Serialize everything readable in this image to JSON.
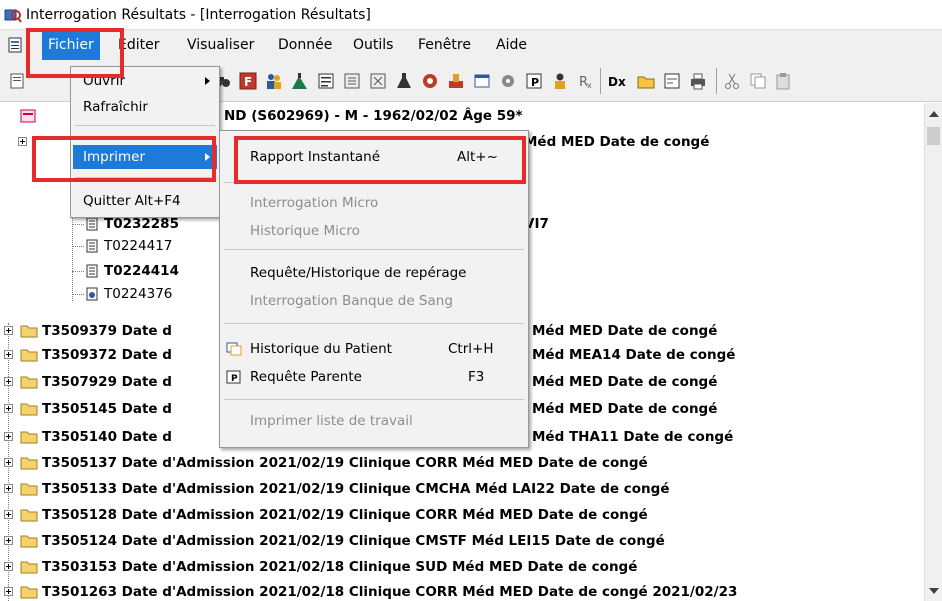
{
  "window": {
    "title": "Interrogation Résultats - [Interrogation Résultats]"
  },
  "menubar": {
    "items": [
      "Fichier",
      "Éditer",
      "Visualiser",
      "Donnée",
      "Outils",
      "Fenêtre",
      "Aide"
    ]
  },
  "toolbar": {
    "icons": [
      "print-icon",
      "binoculars-icon",
      "red-f-icon",
      "people-icon",
      "mountain-icon",
      "list-icon",
      "tree-icon",
      "tree-alt-icon",
      "flask-icon",
      "bio-icon",
      "stamp-icon",
      "window-icon",
      "gear-icon",
      "bracket-p-icon",
      "person-icon",
      "rx-icon",
      "dx-icon",
      "folder-open-icon",
      "form-icon",
      "printer-icon",
      "scissors-icon",
      "copy-icon",
      "paste-icon"
    ],
    "dx_label": "Dx"
  },
  "tree": {
    "patient_header": "ND (S602969) - M - 1962/02/02 Âge 59*",
    "row1_tail": "Méd MED Date de congé",
    "row_vi7_tail": "VI7",
    "sub_items": [
      "T0232285",
      "T0224417",
      "T0224414",
      "T0224376"
    ],
    "partial_rows": [
      {
        "id": "T3509379 Date d",
        "tail": "Méd MED Date de congé"
      },
      {
        "id": "T3509372 Date d",
        "tail": "Méd MEA14 Date de congé"
      },
      {
        "id": "T3507929 Date d",
        "tail": "Méd MED Date de congé"
      },
      {
        "id": "T3505145 Date d",
        "tail": "Méd MED Date de congé"
      },
      {
        "id": "T3505140 Date d",
        "tail": "Méd THA11 Date de congé"
      }
    ],
    "full_rows": [
      "T3505137 Date d'Admission 2021/02/19 Clinique CORR Méd MED Date de congé",
      "T3505133 Date d'Admission 2021/02/19 Clinique CMCHA Méd LAI22 Date de congé",
      "T3505128 Date d'Admission 2021/02/19 Clinique CORR Méd MED Date de congé",
      "T3505124 Date d'Admission 2021/02/19 Clinique CMSTF Méd LEI15 Date de congé",
      "T3503153 Date d'Admission 2021/02/18 Clinique SUD Méd MED Date de congé",
      "T3501263 Date d'Admission 2021/02/18 Clinique CORR Méd MED Date de congé 2021/02/23"
    ]
  },
  "file_menu": {
    "items": [
      {
        "label": "Ouvrir",
        "has_submenu": true
      },
      {
        "label": "Rafraîchir"
      },
      {
        "label": "Imprimer",
        "has_submenu": true,
        "highlighted": true
      },
      {
        "label": "Quitter Alt+F4"
      }
    ]
  },
  "print_submenu": {
    "items": [
      {
        "label": "Rapport Instantané",
        "shortcut": "Alt+~",
        "enabled": true
      },
      {
        "label": "Interrogation Micro",
        "enabled": false
      },
      {
        "label": "Historique Micro",
        "enabled": false
      },
      {
        "label": "Requête/Historique de repérage",
        "enabled": true
      },
      {
        "label": "Interrogation Banque de Sang",
        "enabled": false
      },
      {
        "label": "Historique du Patient",
        "shortcut": "Ctrl+H",
        "enabled": true,
        "icon": "patient-history-icon"
      },
      {
        "label": "Requête Parente",
        "shortcut": "F3",
        "enabled": true,
        "icon": "bracket-p-icon"
      },
      {
        "label": "Imprimer liste de travail",
        "enabled": false
      }
    ]
  },
  "colors": {
    "highlight": "#1e7ad8",
    "annotation": "#e52b2b",
    "folder": "#f5d36b",
    "disabled_text": "#8d8d8d"
  }
}
